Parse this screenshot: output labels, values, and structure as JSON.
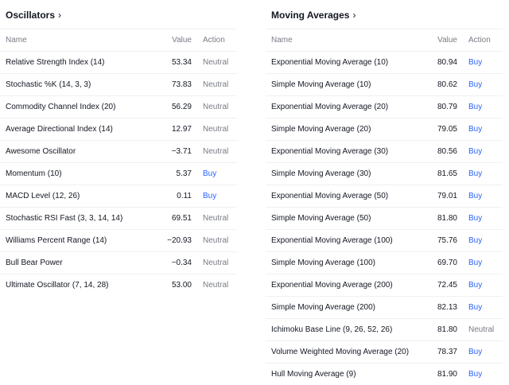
{
  "oscillators": {
    "title": "Oscillators",
    "headers": {
      "name": "Name",
      "value": "Value",
      "action": "Action"
    },
    "rows": [
      {
        "name": "Relative Strength Index (14)",
        "value": "53.34",
        "action": "Neutral"
      },
      {
        "name": "Stochastic %K (14, 3, 3)",
        "value": "73.83",
        "action": "Neutral"
      },
      {
        "name": "Commodity Channel Index (20)",
        "value": "56.29",
        "action": "Neutral"
      },
      {
        "name": "Average Directional Index (14)",
        "value": "12.97",
        "action": "Neutral"
      },
      {
        "name": "Awesome Oscillator",
        "value": "−3.71",
        "action": "Neutral"
      },
      {
        "name": "Momentum (10)",
        "value": "5.37",
        "action": "Buy"
      },
      {
        "name": "MACD Level (12, 26)",
        "value": "0.11",
        "action": "Buy"
      },
      {
        "name": "Stochastic RSI Fast (3, 3, 14, 14)",
        "value": "69.51",
        "action": "Neutral"
      },
      {
        "name": "Williams Percent Range (14)",
        "value": "−20.93",
        "action": "Neutral"
      },
      {
        "name": "Bull Bear Power",
        "value": "−0.34",
        "action": "Neutral"
      },
      {
        "name": "Ultimate Oscillator (7, 14, 28)",
        "value": "53.00",
        "action": "Neutral"
      }
    ]
  },
  "moving_averages": {
    "title": "Moving Averages",
    "headers": {
      "name": "Name",
      "value": "Value",
      "action": "Action"
    },
    "rows": [
      {
        "name": "Exponential Moving Average (10)",
        "value": "80.94",
        "action": "Buy"
      },
      {
        "name": "Simple Moving Average (10)",
        "value": "80.62",
        "action": "Buy"
      },
      {
        "name": "Exponential Moving Average (20)",
        "value": "80.79",
        "action": "Buy"
      },
      {
        "name": "Simple Moving Average (20)",
        "value": "79.05",
        "action": "Buy"
      },
      {
        "name": "Exponential Moving Average (30)",
        "value": "80.56",
        "action": "Buy"
      },
      {
        "name": "Simple Moving Average (30)",
        "value": "81.65",
        "action": "Buy"
      },
      {
        "name": "Exponential Moving Average (50)",
        "value": "79.01",
        "action": "Buy"
      },
      {
        "name": "Simple Moving Average (50)",
        "value": "81.80",
        "action": "Buy"
      },
      {
        "name": "Exponential Moving Average (100)",
        "value": "75.76",
        "action": "Buy"
      },
      {
        "name": "Simple Moving Average (100)",
        "value": "69.70",
        "action": "Buy"
      },
      {
        "name": "Exponential Moving Average (200)",
        "value": "72.45",
        "action": "Buy"
      },
      {
        "name": "Simple Moving Average (200)",
        "value": "82.13",
        "action": "Buy"
      },
      {
        "name": "Ichimoku Base Line (9, 26, 52, 26)",
        "value": "81.80",
        "action": "Neutral"
      },
      {
        "name": "Volume Weighted Moving Average (20)",
        "value": "78.37",
        "action": "Buy"
      },
      {
        "name": "Hull Moving Average (9)",
        "value": "81.90",
        "action": "Buy"
      }
    ]
  },
  "icons": {
    "title_chevron": "chevron-right-icon"
  },
  "colors": {
    "buy": "#2962ff",
    "neutral": "#787b86",
    "text": "#131722",
    "divider": "#eef0f3"
  }
}
